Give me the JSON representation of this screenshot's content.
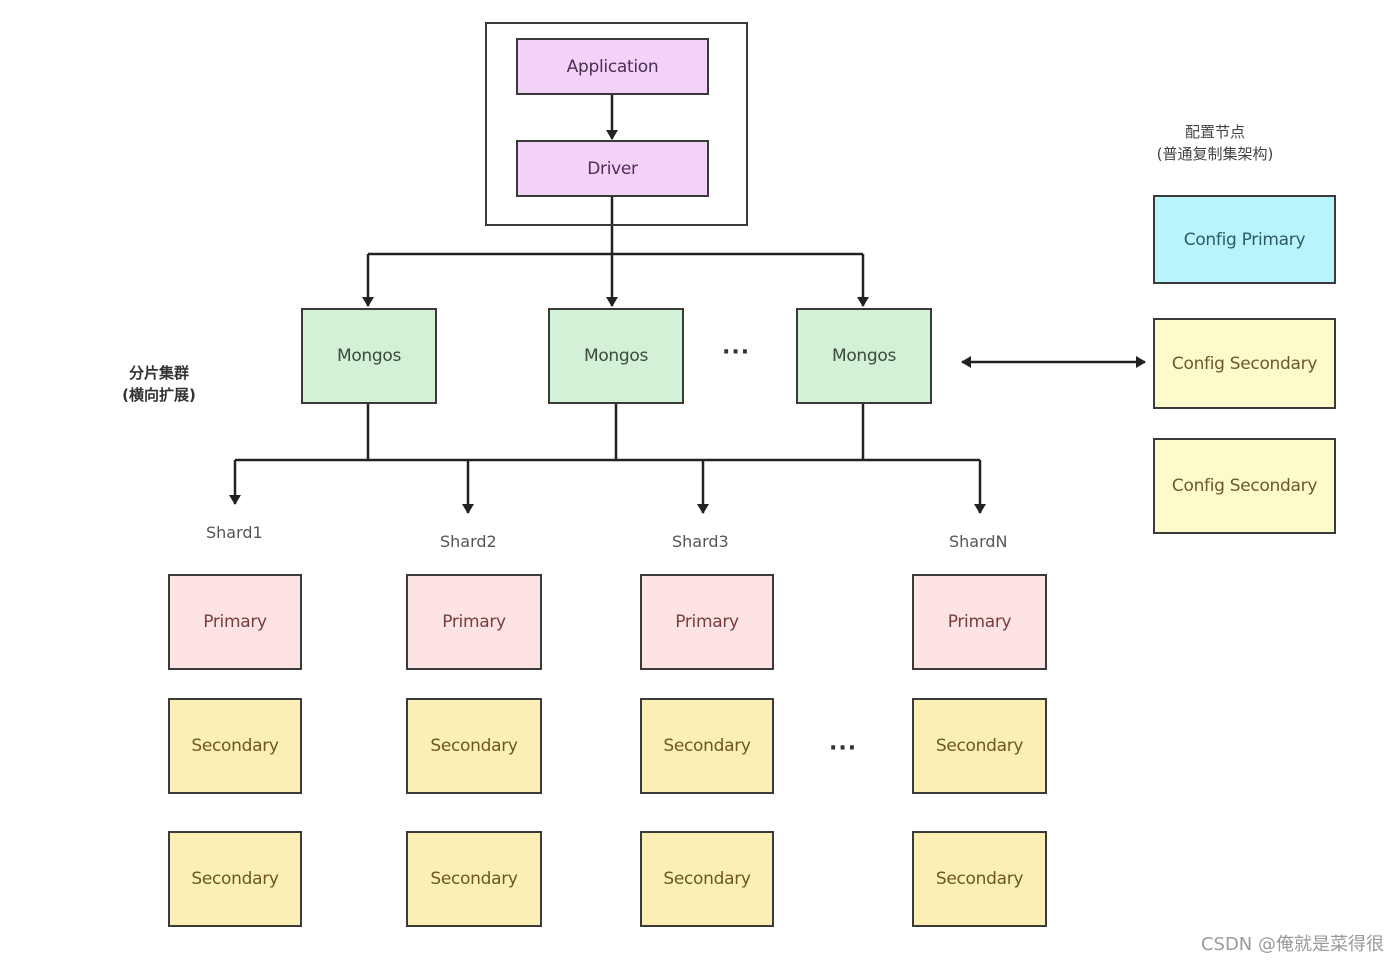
{
  "client": {
    "application": "Application",
    "driver": "Driver"
  },
  "router": {
    "label_line1": "分片集群",
    "label_line2": "(横向扩展)",
    "nodes": [
      "Mongos",
      "Mongos",
      "Mongos"
    ],
    "ellipsis": "···"
  },
  "config": {
    "label_line1": "配置节点",
    "label_line2": "(普通复制集架构)",
    "primary": "Config Primary",
    "secondaries": [
      "Config Secondary",
      "Config Secondary"
    ]
  },
  "shards": [
    {
      "name": "Shard1",
      "primary": "Primary",
      "secondaries": [
        "Secondary",
        "Secondary"
      ]
    },
    {
      "name": "Shard2",
      "primary": "Primary",
      "secondaries": [
        "Secondary",
        "Secondary"
      ]
    },
    {
      "name": "Shard3",
      "primary": "Primary",
      "secondaries": [
        "Secondary",
        "Secondary"
      ]
    },
    {
      "name": "ShardN",
      "primary": "Primary",
      "secondaries": [
        "Secondary",
        "Secondary"
      ]
    }
  ],
  "shard_ellipsis": "···",
  "watermark": "CSDN @俺就是菜得很",
  "colors": {
    "client": "#f3d2f7",
    "mongos": "#d3f1d7",
    "primary": "#fde3e3",
    "secondary": "#fbefb6",
    "config_primary": "#b7f4fb",
    "config_secondary": "#fdfacb"
  }
}
